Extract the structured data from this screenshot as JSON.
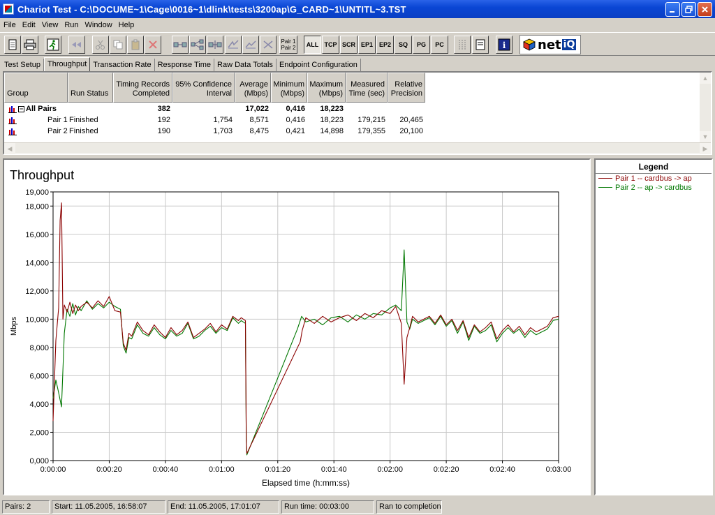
{
  "window": {
    "title": "Chariot Test - C:\\DOCUME~1\\Cage\\0016~1\\dlink\\tests\\3200ap\\G_CARD~1\\UNTITL~3.TST",
    "minimize_icon": "minimize-icon",
    "restore_icon": "restore-icon",
    "close_icon": "close-icon"
  },
  "menu": {
    "items": [
      "File",
      "Edit",
      "View",
      "Run",
      "Window",
      "Help"
    ]
  },
  "toolbar": {
    "pair_label_1": "Pair 1",
    "pair_label_2": "Pair 2",
    "filters": [
      "ALL",
      "TCP",
      "SCR",
      "EP1",
      "EP2",
      "SQ",
      "PG",
      "PC"
    ],
    "info_label": "i",
    "logo_text": "net",
    "logo_suffix": "iQ"
  },
  "tabs": [
    "Test Setup",
    "Throughput",
    "Transaction Rate",
    "Response Time",
    "Raw Data Totals",
    "Endpoint Configuration"
  ],
  "active_tab": "Throughput",
  "results": {
    "headers": [
      "Group",
      "Run Status",
      "Timing Records\nCompleted",
      "95% Confidence\nInterval",
      "Average\n(Mbps)",
      "Minimum\n(Mbps)",
      "Maximum\n(Mbps)",
      "Measured\nTime (sec)",
      "Relative\nPrecision"
    ],
    "rows": [
      {
        "group": "All Pairs",
        "status": "",
        "records": "382",
        "ci": "",
        "avg": "17,022",
        "min": "0,416",
        "max": "18,223",
        "time": "",
        "precision": ""
      },
      {
        "group": "Pair 1",
        "status": "Finished",
        "records": "192",
        "ci": "1,754",
        "avg": "8,571",
        "min": "0,416",
        "max": "18,223",
        "time": "179,215",
        "precision": "20,465"
      },
      {
        "group": "Pair 2",
        "status": "Finished",
        "records": "190",
        "ci": "1,703",
        "avg": "8,475",
        "min": "0,421",
        "max": "14,898",
        "time": "179,355",
        "precision": "20,100"
      }
    ]
  },
  "legend": {
    "title": "Legend",
    "items": [
      {
        "label": "Pair 1 -- cardbus -> ap",
        "color": "#8b0000"
      },
      {
        "label": "Pair 2 -- ap -> cardbus",
        "color": "#007700"
      }
    ]
  },
  "status_bar": {
    "pairs": "Pairs: 2",
    "start": "Start: 11.05.2005, 16:58:07",
    "end": "End: 11.05.2005, 17:01:07",
    "run_time": "Run time: 00:03:00",
    "message": "Ran to completion"
  },
  "chart_data": {
    "type": "line",
    "title": "Throughput",
    "xlabel": "Elapsed time (h:mm:ss)",
    "ylabel": "Mbps",
    "xlim": [
      0,
      180
    ],
    "ylim": [
      0,
      19000
    ],
    "x_ticks": [
      0,
      20,
      40,
      60,
      80,
      100,
      120,
      140,
      160,
      180
    ],
    "x_tick_labels": [
      "0:00:00",
      "0:00:20",
      "0:00:40",
      "0:01:00",
      "0:01:20",
      "0:01:40",
      "0:02:00",
      "0:02:20",
      "0:02:40",
      "0:03:00"
    ],
    "y_ticks": [
      0,
      2000,
      4000,
      6000,
      8000,
      10000,
      12000,
      14000,
      16000,
      18000,
      19000
    ],
    "y_tick_labels": [
      "0,000",
      "2,000",
      "4,000",
      "6,000",
      "8,000",
      "10,000",
      "12,000",
      "14,000",
      "16,000",
      "18,000",
      "19,000"
    ],
    "grid": true,
    "series": [
      {
        "name": "Pair 1 -- cardbus -> ap",
        "color": "#8b0000",
        "x": [
          0,
          1,
          2,
          2.5,
          3,
          3.5,
          4,
          5,
          6,
          7,
          8,
          9,
          10,
          12,
          14,
          16,
          18,
          20,
          22,
          24,
          25,
          26,
          27,
          28,
          30,
          32,
          34,
          36,
          38,
          40,
          42,
          44,
          46,
          48,
          50,
          52,
          54,
          56,
          58,
          60,
          62,
          64,
          66,
          67,
          68.5,
          68.8,
          69,
          88,
          88.7,
          90,
          93,
          96,
          99,
          102,
          105,
          108,
          111,
          114,
          117,
          120,
          122,
          124,
          125,
          126,
          127,
          128,
          130,
          132,
          134,
          136,
          138,
          140,
          142,
          144,
          146,
          148,
          150,
          152,
          154,
          156,
          158,
          160,
          162,
          164,
          166,
          168,
          170,
          172,
          174,
          176,
          178,
          180
        ],
        "y": [
          2800,
          8500,
          10800,
          17000,
          18223,
          10000,
          11000,
          10500,
          11200,
          10400,
          11000,
          10600,
          10900,
          11200,
          10800,
          11300,
          10900,
          11600,
          10600,
          10500,
          8300,
          7800,
          9000,
          8800,
          9800,
          9200,
          8900,
          9600,
          9100,
          8700,
          9400,
          8900,
          9200,
          9800,
          8700,
          9000,
          9300,
          9700,
          9100,
          9600,
          9300,
          10200,
          9900,
          10100,
          9900,
          1600,
          500,
          8400,
          9200,
          10100,
          9700,
          10200,
          9800,
          10100,
          10300,
          9900,
          10400,
          10100,
          10600,
          10400,
          10900,
          9700,
          5400,
          8700,
          9400,
          10200,
          9800,
          10000,
          10200,
          9700,
          10300,
          9600,
          10000,
          9200,
          9900,
          8700,
          9600,
          9100,
          9400,
          9800,
          8600,
          9200,
          9600,
          9100,
          9500,
          8900,
          9400,
          9100,
          9300,
          9500,
          10100,
          10200
        ]
      },
      {
        "name": "Pair 2 -- ap -> cardbus",
        "color": "#007700",
        "x": [
          0,
          1,
          2,
          3,
          4,
          5,
          6,
          7,
          8,
          9,
          10,
          12,
          14,
          16,
          18,
          20,
          22,
          24,
          25,
          26,
          27,
          28,
          30,
          32,
          34,
          36,
          38,
          40,
          42,
          44,
          46,
          48,
          50,
          52,
          54,
          56,
          58,
          60,
          62,
          64,
          66,
          67,
          68.5,
          68.8,
          69,
          87,
          88.5,
          90,
          93,
          96,
          99,
          102,
          105,
          108,
          111,
          114,
          117,
          120,
          122,
          124,
          125,
          126,
          127,
          128,
          130,
          132,
          134,
          136,
          138,
          140,
          142,
          144,
          146,
          148,
          150,
          152,
          154,
          156,
          158,
          160,
          162,
          164,
          166,
          168,
          170,
          172,
          174,
          176,
          178,
          180
        ],
        "y": [
          4400,
          5700,
          4800,
          3800,
          9000,
          10700,
          10200,
          11100,
          10300,
          10900,
          10600,
          11300,
          10700,
          11100,
          10800,
          11200,
          10900,
          10700,
          8100,
          7600,
          8700,
          8600,
          9600,
          9000,
          8800,
          9400,
          8900,
          8600,
          9200,
          8800,
          9000,
          9700,
          8600,
          8800,
          9200,
          9500,
          9000,
          9400,
          9200,
          10100,
          9700,
          9900,
          9700,
          1500,
          400,
          9300,
          10200,
          9800,
          10000,
          9600,
          10100,
          10200,
          9800,
          10300,
          10000,
          10400,
          10300,
          10800,
          11000,
          10600,
          14898,
          9800,
          9300,
          10000,
          9700,
          9900,
          10100,
          9600,
          10200,
          9500,
          9900,
          9000,
          9800,
          8500,
          9500,
          9000,
          9200,
          9600,
          8400,
          9000,
          9400,
          9000,
          9300,
          8700,
          9200,
          8900,
          9100,
          9300,
          9900,
          10000
        ]
      }
    ]
  }
}
